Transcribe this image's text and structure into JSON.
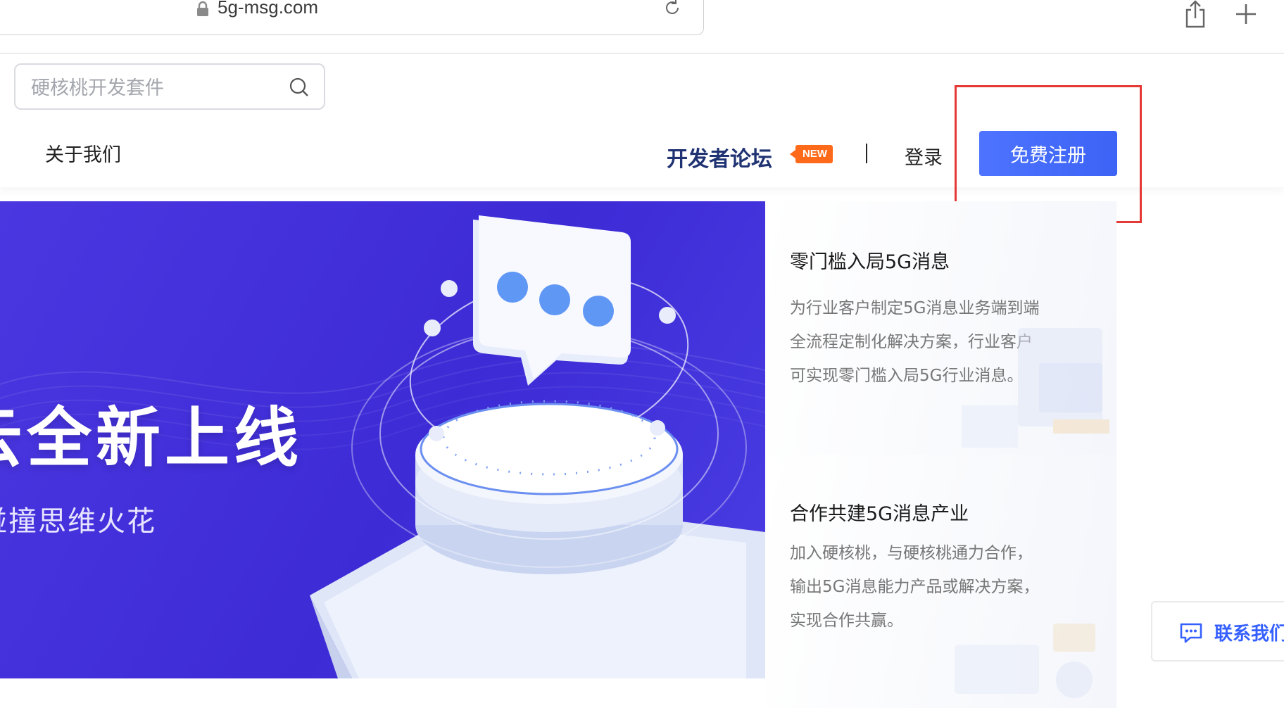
{
  "browser": {
    "url": "5g-msg.com",
    "icons": [
      "lock-icon",
      "reload-icon",
      "share-icon",
      "new-tab-icon"
    ]
  },
  "header": {
    "search_placeholder": "硬核桃开发套件",
    "nav_about": "关于我们",
    "nav_forum": "开发者论坛",
    "new_badge": "NEW",
    "divider": "|",
    "login": "登录",
    "register": "免费注册"
  },
  "banner": {
    "title": "云全新上线",
    "subtitle": "碰撞思维火花"
  },
  "features": [
    {
      "title": "零门槛入局5G消息",
      "desc_lines": [
        "为行业客户制定5G消息业务端到端",
        "全流程定制化解决方案，行业客户",
        "可实现零门槛入局5G行业消息。"
      ]
    },
    {
      "title": "合作共建5G消息产业",
      "desc_lines": [
        "加入硬核桃，与硬核桃通力合作，",
        "输出5G消息能力产品或解决方案，",
        "实现合作共赢。"
      ]
    }
  ],
  "contact": {
    "label": "联系我们"
  },
  "colors": {
    "brand_blue": "#3c63f5",
    "forum_navy": "#1f3272",
    "badge_orange": "#ff6a1a",
    "banner_purple": "#4333db",
    "highlight_red": "#e53935"
  }
}
